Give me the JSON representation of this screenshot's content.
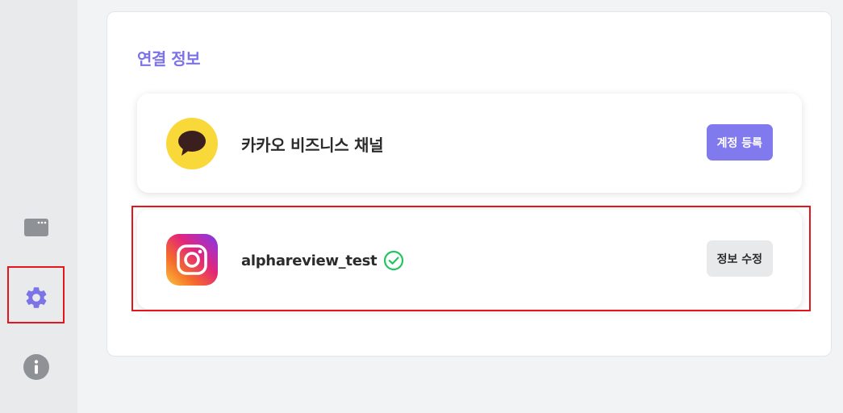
{
  "sidebar": {
    "items": [
      {
        "icon": "window-icon"
      },
      {
        "icon": "gear-icon",
        "active": true
      },
      {
        "icon": "info-icon"
      }
    ]
  },
  "connection": {
    "title": "연결 정보",
    "accounts": [
      {
        "name": "카카오 비즈니스 채널",
        "icon": "kakao-chat-icon",
        "button": "계정 등록",
        "verified": false
      },
      {
        "name": "alphareview_test",
        "icon": "instagram-icon",
        "button": "정보 수정",
        "verified": true
      }
    ]
  },
  "colors": {
    "accent": "#7c73e6",
    "primary_button": "#8179ee",
    "verified": "#22c55e",
    "kakao": "#f9d83a",
    "highlight": "#e6141b"
  }
}
